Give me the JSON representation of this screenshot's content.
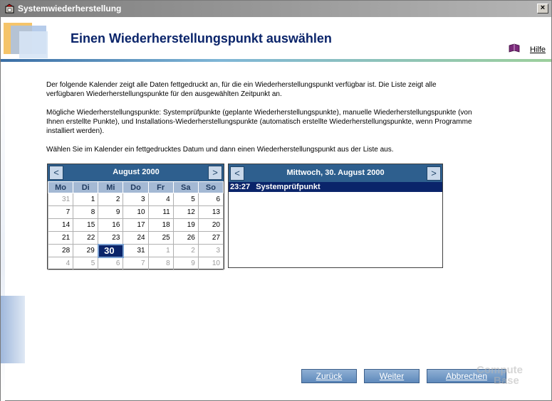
{
  "window": {
    "title": "Systemwiederherstellung",
    "close_label": "×"
  },
  "header": {
    "title": "Einen Wiederherstellungspunkt auswählen",
    "help_label": "Hilfe"
  },
  "paragraphs": [
    "Der folgende Kalender zeigt alle Daten fettgedruckt an, für die ein Wiederherstellungspunkt verfügbar ist. Die Liste zeigt alle verfügbaren Wiederherstellungspunkte für den ausgewählten Zeitpunkt an.",
    "Mögliche Wiederherstellungspunkte: Systemprüfpunkte (geplante Wiederherstellungspunkte), manuelle Wiederherstellungspunkte (von Ihnen erstellte Punkte), und Installations-Wiederherstellungspunkte (automatisch erstellte Wiederherstellungspunkte, wenn Programme installiert werden).",
    "Wählen Sie im Kalender ein fettgedrucktes Datum und dann einen Wiederherstellungspunkt aus der Liste aus."
  ],
  "calendar": {
    "prev_label": "<",
    "next_label": ">",
    "month": "August 2000",
    "weekdays": [
      "Mo",
      "Di",
      "Mi",
      "Do",
      "Fr",
      "Sa",
      "So"
    ],
    "weeks": [
      [
        "31",
        "1",
        "2",
        "3",
        "4",
        "5",
        "6"
      ],
      [
        "7",
        "8",
        "9",
        "10",
        "11",
        "12",
        "13"
      ],
      [
        "14",
        "15",
        "16",
        "17",
        "18",
        "19",
        "20"
      ],
      [
        "21",
        "22",
        "23",
        "24",
        "25",
        "26",
        "27"
      ],
      [
        "28",
        "29",
        "30",
        "31",
        "1",
        "2",
        "3"
      ],
      [
        "4",
        "5",
        "6",
        "7",
        "8",
        "9",
        "10"
      ]
    ],
    "selected_day": "30"
  },
  "restore_list": {
    "prev_label": "<",
    "next_label": ">",
    "date_title": "Mittwoch, 30. August 2000",
    "items": [
      {
        "time": "23:27",
        "name": "Systemprüfpunkt"
      }
    ]
  },
  "buttons": {
    "back": "Zurück",
    "next": "Weiter",
    "cancel": "Abbrechen"
  },
  "watermark": {
    "line1": "Compute",
    "line2": "Base"
  },
  "colors": {
    "header_title": "#0a246a",
    "calendar_header": "#2e5f8e",
    "selection": "#0a246a",
    "button": "#5e89bb"
  }
}
